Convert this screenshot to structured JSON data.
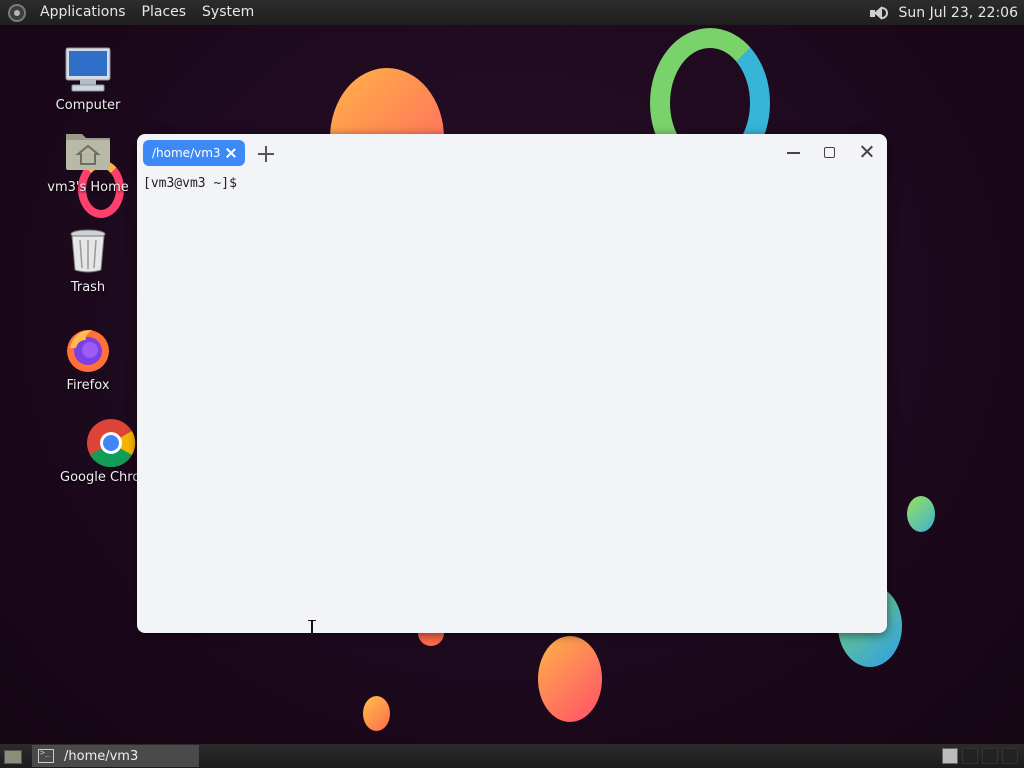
{
  "top_panel": {
    "menus": [
      "Applications",
      "Places",
      "System"
    ],
    "clock": "Sun Jul 23, 22:06"
  },
  "desktop_icons": [
    {
      "label": "Computer",
      "icon": "computer-icon"
    },
    {
      "label": "vm3's Home",
      "icon": "home-folder-icon"
    },
    {
      "label": "Trash",
      "icon": "trash-icon"
    },
    {
      "label": "Firefox",
      "icon": "firefox-icon"
    },
    {
      "label": "Google Chrome",
      "icon": "chrome-icon"
    }
  ],
  "terminal": {
    "tab_title": "/home/vm3",
    "prompt": "[vm3@vm3 ~]$"
  },
  "bottom_panel": {
    "task_label": "/home/vm3"
  },
  "colors": {
    "tab_accent": "#3d8af7",
    "terminal_bg": "#f3f4f8",
    "desktop_bg": "#1c0a1d"
  }
}
